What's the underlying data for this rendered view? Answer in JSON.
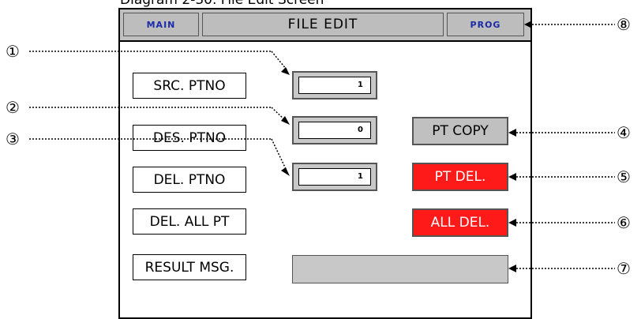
{
  "caption": "Diagram 2-30. File Edit Screen",
  "topbar": {
    "main_label": "MAIN",
    "title": "FILE EDIT",
    "prog_label": "PROG"
  },
  "rows": [
    {
      "label": "SRC. PTNO",
      "value": "1"
    },
    {
      "label": "DES. PTNO",
      "value": "0"
    },
    {
      "label": "DEL. PTNO",
      "value": "1"
    },
    {
      "label": "DEL. ALL PT"
    },
    {
      "label": "RESULT MSG."
    }
  ],
  "buttons": {
    "pt_copy": "PT COPY",
    "pt_del": "PT DEL.",
    "all_del": "ALL DEL."
  },
  "callouts": [
    "①",
    "②",
    "③",
    "④",
    "⑤",
    "⑥",
    "⑦",
    "⑧"
  ],
  "colors": {
    "red_button": "#ff1a1a",
    "blue_text": "#1a2aa8",
    "panel_grey": "#c0c0c0"
  }
}
